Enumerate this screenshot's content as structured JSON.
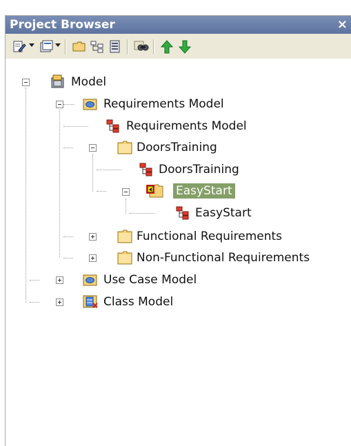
{
  "window": {
    "title": "Project Browser",
    "close_glyph": "×"
  },
  "toolbar": {
    "items": [
      {
        "name": "new-element-icon"
      },
      {
        "name": "new-diagram-icon"
      },
      {
        "name": "new-package-icon"
      },
      {
        "name": "tree-view-icon"
      },
      {
        "name": "properties-icon"
      },
      {
        "name": "find-icon"
      },
      {
        "name": "move-up-icon"
      },
      {
        "name": "move-down-icon"
      }
    ]
  },
  "tree": {
    "root": "Model",
    "requirements_model": "Requirements Model",
    "requirements_model_diagram": "Requirements Model",
    "doors_training": "DoorsTraining",
    "doors_training_diagram": "DoorsTraining",
    "easy_start": "EasyStart",
    "easy_start_diagram": "EasyStart",
    "functional": "Functional Requirements",
    "non_functional": "Non-Functional Requirements",
    "use_case_model": "Use Case Model",
    "class_model": "Class Model"
  },
  "colors": {
    "title_bar": "#6a7fa9",
    "selection": "#859f68",
    "toolbar": "#ece9d8"
  }
}
